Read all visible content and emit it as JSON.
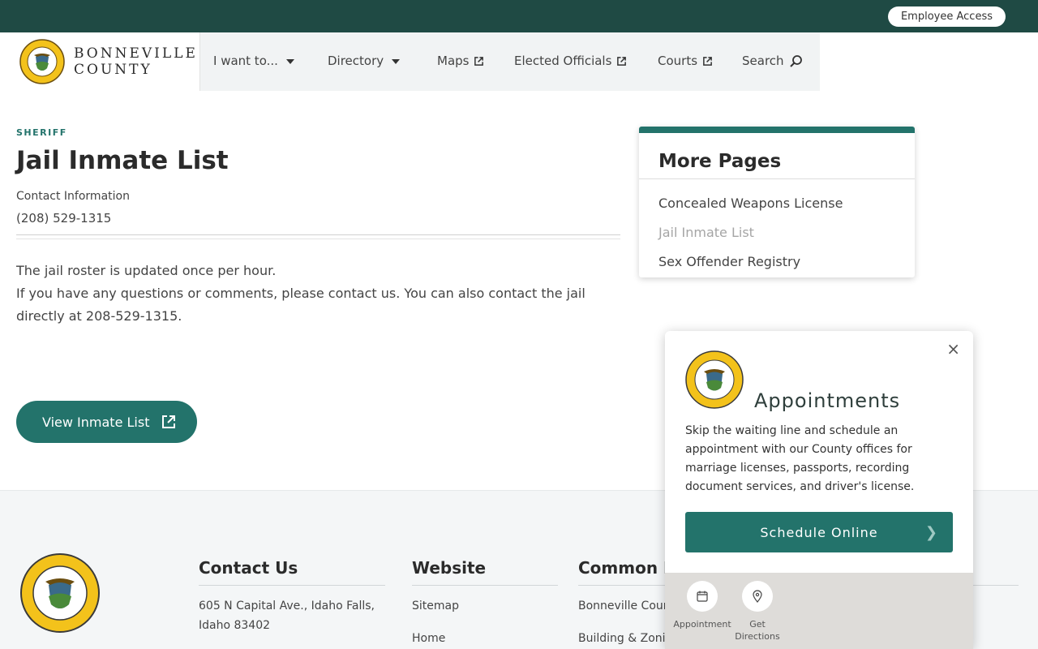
{
  "topbar": {
    "employee_access": "Employee Access"
  },
  "brand": {
    "line1": "BONNEVILLE",
    "line2": "COUNTY"
  },
  "nav": {
    "i_want_to": "I want to...",
    "directory": "Directory",
    "maps": "Maps",
    "elected_officials": "Elected Officials",
    "courts": "Courts",
    "search": "Search"
  },
  "page": {
    "department": "SHERIFF",
    "title": "Jail Inmate List",
    "contact_label": "Contact Information",
    "contact_phone": "(208) 529-1315",
    "body_line1": "The jail roster is updated once per hour.",
    "body_line2": "If you have any questions or comments, please contact us. You can also contact the jail directly at 208-529-1315.",
    "view_button": "View Inmate List"
  },
  "more_pages": {
    "heading": "More Pages",
    "links": [
      "Concealed Weapons License",
      "Jail Inmate List",
      "Sex Offender Registry"
    ]
  },
  "footer": {
    "contact_heading": "Contact Us",
    "address": "605 N Capital Ave., Idaho Falls, Idaho 83402",
    "website_heading": "Website",
    "website_links": [
      "Sitemap",
      "Home"
    ],
    "common_heading": "Common R",
    "common_links": [
      "Bonneville Coun",
      "Building & Zonin"
    ]
  },
  "popup": {
    "close": "×",
    "heading": "Appointments",
    "text": "Skip the waiting line and schedule an appointment with our County offices for marriage licenses, passports, recording document services, and driver's license.",
    "button": "Schedule Online",
    "actions": [
      "Appointment",
      "Get Directions"
    ]
  },
  "colors": {
    "brand_dark": "#1f4a44",
    "accent": "#23736b",
    "footer_bg": "#f4f6f7"
  }
}
